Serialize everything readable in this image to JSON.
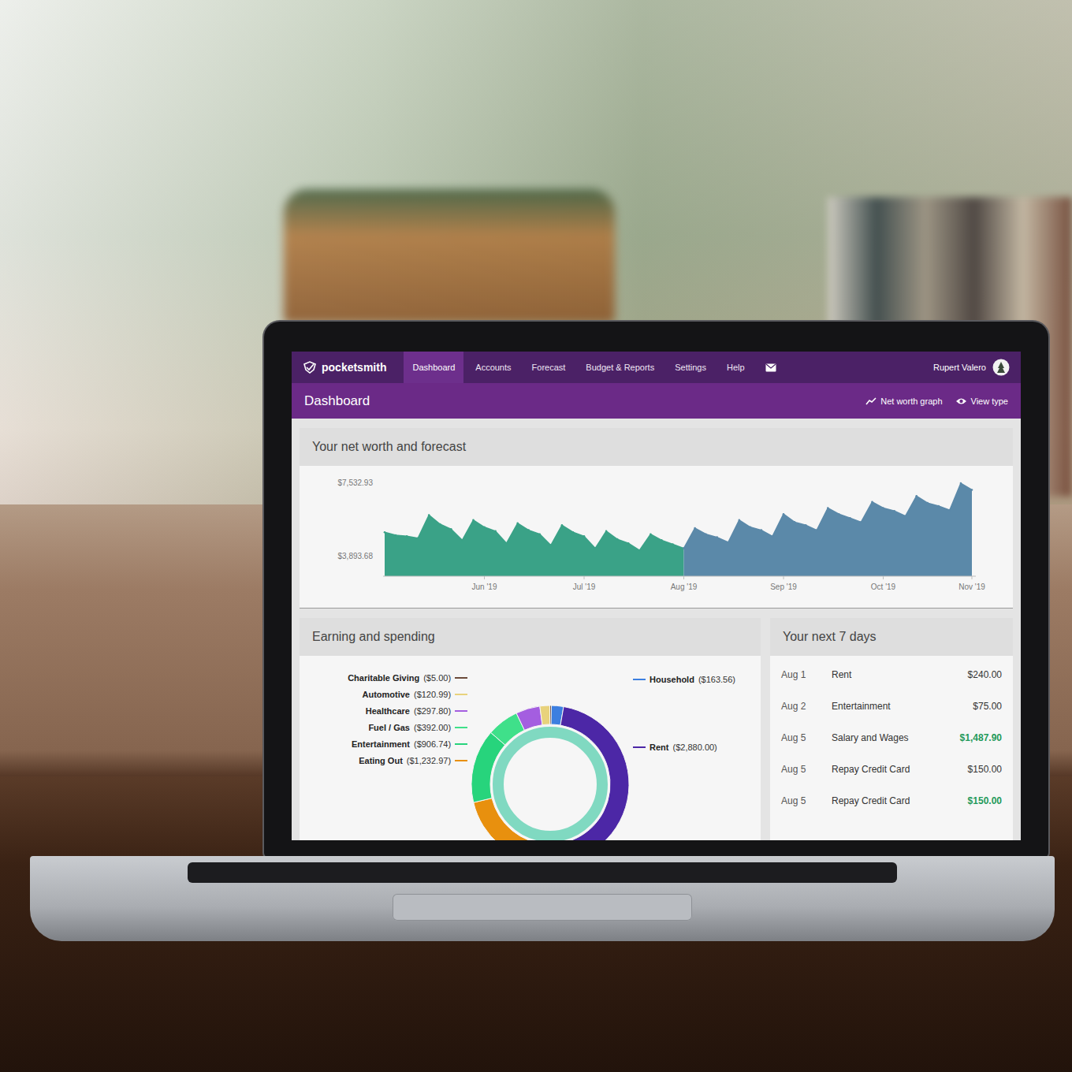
{
  "app": {
    "logo": "pocketsmith",
    "user": "Rupert Valero"
  },
  "nav": [
    {
      "label": "Dashboard",
      "selected": true
    },
    {
      "label": "Accounts",
      "selected": false
    },
    {
      "label": "Forecast",
      "selected": false
    },
    {
      "label": "Budget & Reports",
      "selected": false
    },
    {
      "label": "Settings",
      "selected": false
    },
    {
      "label": "Help",
      "selected": false
    }
  ],
  "header": {
    "title": "Dashboard",
    "actions": [
      "Net worth graph",
      "View type"
    ]
  },
  "net_worth": {
    "title": "Your net worth and forecast",
    "y_ticks": [
      "$7,532.93",
      "$3,893.68"
    ],
    "y_range": [
      3893.68,
      7532.93
    ],
    "x_ticks": [
      "Jun '19",
      "Jul '19",
      "Aug '19",
      "Sep '19",
      "Oct '19",
      "Nov '19"
    ],
    "series": [
      {
        "color": "#3aa287",
        "values": [
          5100,
          4950,
          4900,
          4800,
          5950,
          5500,
          5250,
          4700,
          5700,
          5350,
          5150,
          4550,
          5550,
          5200,
          5000,
          4450,
          5450,
          5100,
          4900,
          4300,
          5150,
          4750,
          4550,
          4200,
          5000,
          4700,
          4500,
          4300
        ]
      },
      {
        "color": "#5b89a9",
        "values": [
          4300,
          5300,
          5000,
          4850,
          4600,
          5700,
          5350,
          5200,
          4900,
          6000,
          5600,
          5450,
          5200,
          6300,
          6000,
          5800,
          5600,
          6600,
          6300,
          6150,
          5900,
          6900,
          6550,
          6400,
          6200,
          7532.93,
          7200
        ]
      }
    ]
  },
  "spending": {
    "title": "Earning and spending",
    "categories": [
      {
        "label": "Household",
        "amount": "($163.56)",
        "value": 163.56,
        "color": "#3d7fe0"
      },
      {
        "label": "Rent",
        "amount": "($2,880.00)",
        "value": 2880.0,
        "color": "#4c27a6"
      },
      {
        "label": "Eating Out",
        "amount": "($1,232.97)",
        "value": 1232.97,
        "color": "#e8900e"
      },
      {
        "label": "Entertainment",
        "amount": "($906.74)",
        "value": 906.74,
        "color": "#27d47c"
      },
      {
        "label": "Fuel / Gas",
        "amount": "($392.00)",
        "value": 392.0,
        "color": "#3fe08a"
      },
      {
        "label": "Healthcare",
        "amount": "($297.80)",
        "value": 297.8,
        "color": "#a45ee0"
      },
      {
        "label": "Automotive",
        "amount": "($120.99)",
        "value": 120.99,
        "color": "#e8d27c"
      },
      {
        "label": "Charitable Giving",
        "amount": "($5.00)",
        "value": 5.0,
        "color": "#6b4a3a"
      }
    ]
  },
  "upcoming": {
    "title": "Your next 7 days",
    "rows": [
      {
        "date": "Aug 1",
        "name": "Rent",
        "amount": "$240.00",
        "income": false
      },
      {
        "date": "Aug 2",
        "name": "Entertainment",
        "amount": "$75.00",
        "income": false
      },
      {
        "date": "Aug 5",
        "name": "Salary and Wages",
        "amount": "$1,487.90",
        "income": true
      },
      {
        "date": "Aug 5",
        "name": "Repay Credit Card",
        "amount": "$150.00",
        "income": false
      },
      {
        "date": "Aug 5",
        "name": "Repay Credit Card",
        "amount": "$150.00",
        "income": true
      }
    ]
  }
}
